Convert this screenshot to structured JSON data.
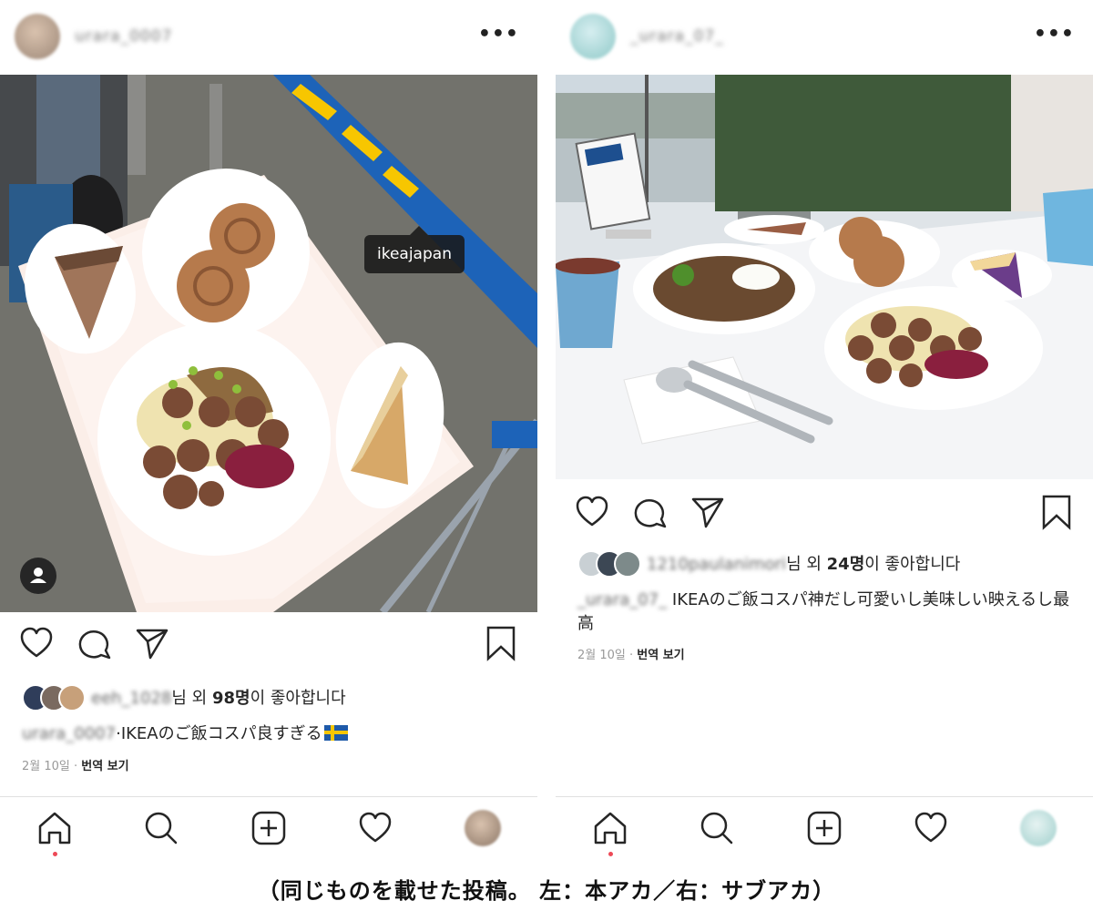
{
  "left_post": {
    "username": "urara_0007",
    "photo_tag": "ikeajapan",
    "likes": {
      "liker": "eeh_1028",
      "prefix": "님 외 ",
      "count": "98명",
      "suffix": "이 좋아합니다"
    },
    "caption": {
      "author": "urara_0007",
      "text": "IKEAのご飯コスパ良すぎる"
    },
    "date": "2월 10일",
    "separator": " · ",
    "translate": "번역 보기"
  },
  "right_post": {
    "username": "_urara_07_",
    "likes": {
      "liker": "1210paulanimori",
      "prefix": "님 외 ",
      "count": "24명",
      "suffix": "이 좋아합니다"
    },
    "caption": {
      "author": "_urara_07_",
      "text": " IKEAのご飯コスパ神だし可愛いし美味しい映えるし最高"
    },
    "date": "2월 10일",
    "separator": " · ",
    "translate": "번역 보기"
  },
  "bottom_caption": "（同じものを載せた投稿。 左：本アカ／右：サブアカ）",
  "icons": [
    "home-icon",
    "search-icon",
    "add-post-icon",
    "activity-heart-icon",
    "profile-avatar",
    "like-heart-icon",
    "comment-icon",
    "share-icon",
    "save-bookmark-icon",
    "more-options-icon",
    "user-tag-icon",
    "sweden-flag-icon"
  ],
  "colors": {
    "notification_dot": "#ed4956",
    "ikea_blue": "#1d63b8",
    "ikea_yellow": "#f7c600",
    "text": "#262626",
    "muted": "#999999"
  }
}
